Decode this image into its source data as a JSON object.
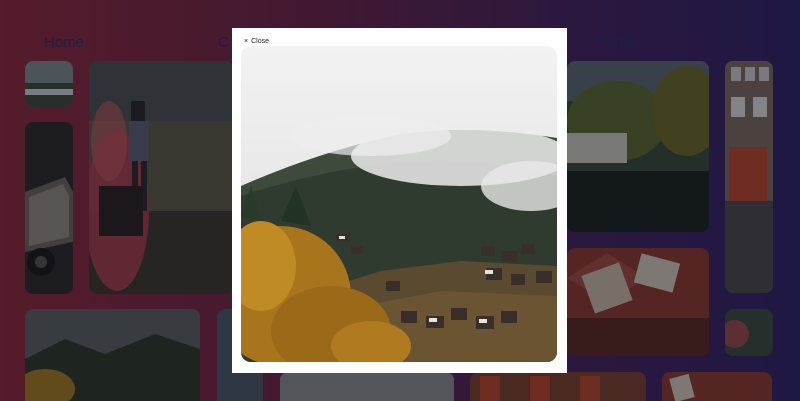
{
  "nav": {
    "home": "Home",
    "c_partial": "C",
    "profile": "Profile"
  },
  "modal": {
    "close_label": "Close",
    "close_icon": "close-icon",
    "image_subject": "foggy-mountain-village-autumn"
  },
  "colors": {
    "overlay_tint": "#8c2a3c",
    "modal_bg": "#ffffff"
  }
}
